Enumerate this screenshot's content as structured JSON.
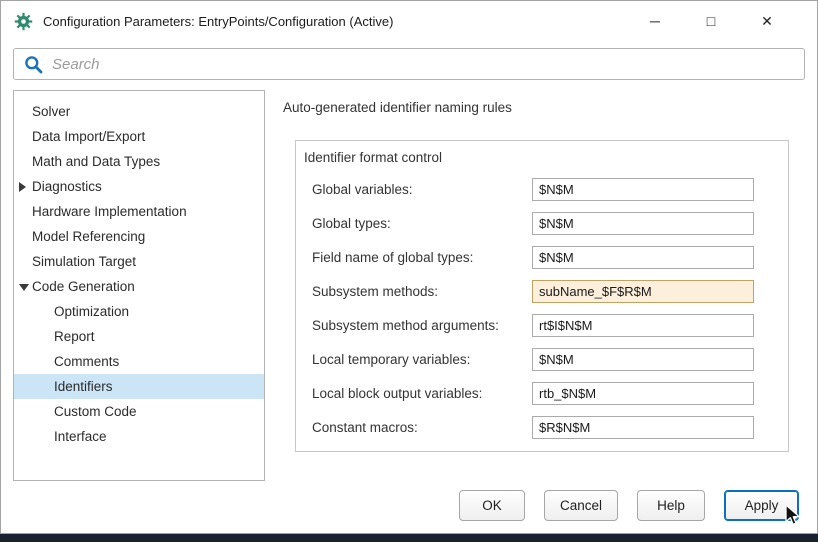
{
  "window": {
    "title": "Configuration Parameters: EntryPoints/Configuration (Active)",
    "controls": {
      "minimize": "─",
      "maximize": "□",
      "close": "✕"
    }
  },
  "search": {
    "placeholder": "Search"
  },
  "sidebar": {
    "items": [
      {
        "label": "Solver"
      },
      {
        "label": "Data Import/Export"
      },
      {
        "label": "Math and Data Types"
      },
      {
        "label": "Diagnostics",
        "arrow": "collapsed"
      },
      {
        "label": "Hardware Implementation"
      },
      {
        "label": "Model Referencing"
      },
      {
        "label": "Simulation Target"
      },
      {
        "label": "Code Generation",
        "arrow": "expanded"
      },
      {
        "label": "Optimization",
        "child": true
      },
      {
        "label": "Report",
        "child": true
      },
      {
        "label": "Comments",
        "child": true
      },
      {
        "label": "Identifiers",
        "child": true,
        "selected": true
      },
      {
        "label": "Custom Code",
        "child": true
      },
      {
        "label": "Interface",
        "child": true
      }
    ]
  },
  "main": {
    "heading": "Auto-generated identifier naming rules",
    "group_title": "Identifier format control",
    "fields": [
      {
        "label": "Global variables:",
        "value": "$N$M",
        "modified": false
      },
      {
        "label": "Global types:",
        "value": "$N$M",
        "modified": false
      },
      {
        "label": "Field name of global types:",
        "value": "$N$M",
        "modified": false
      },
      {
        "label": "Subsystem methods:",
        "value": "subName_$F$R$M",
        "modified": true
      },
      {
        "label": "Subsystem method arguments:",
        "value": "rt$I$N$M",
        "modified": false
      },
      {
        "label": "Local temporary variables:",
        "value": "$N$M",
        "modified": false
      },
      {
        "label": "Local block output variables:",
        "value": "rtb_$N$M",
        "modified": false
      },
      {
        "label": "Constant macros:",
        "value": "$R$N$M",
        "modified": false
      }
    ]
  },
  "footer": {
    "buttons": [
      {
        "label": "OK"
      },
      {
        "label": "Cancel"
      },
      {
        "label": "Help"
      },
      {
        "label": "Apply",
        "focused": true
      }
    ]
  },
  "colors": {
    "tree_selection": "#cbe5f7",
    "modified_field_bg": "#fcf0dd",
    "focus_border": "#0b6fbd",
    "search_icon": "#1a72b8",
    "app_icon": "#2e8b6e",
    "bottom_strip": "#18232f"
  },
  "icons": {
    "app": "simulink-gear",
    "search": "magnifier",
    "diagnostics": "chevron-right",
    "code_generation": "chevron-down"
  }
}
